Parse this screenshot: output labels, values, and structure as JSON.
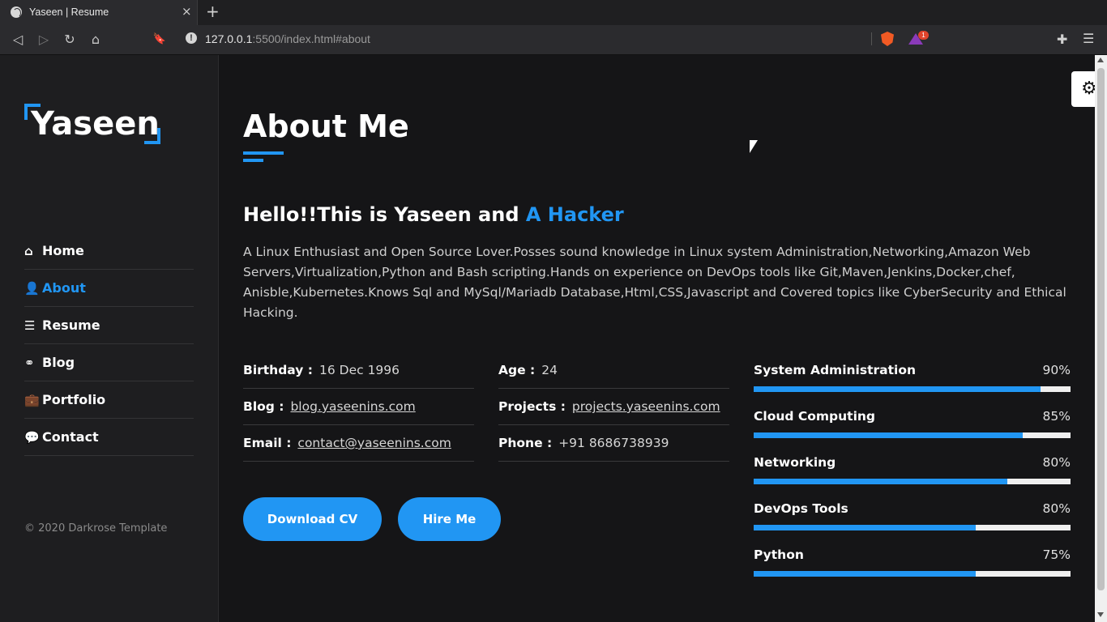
{
  "browser": {
    "tab_title": "Yaseen | Resume",
    "tab_close": "×",
    "new_tab": "+",
    "url_host": "127.0.0.1",
    "url_rest": ":5500/index.html#about",
    "security_icon": "!",
    "rewards_badge": "1",
    "icons": {
      "back": "◁",
      "forward": "▷",
      "reload": "↻",
      "home": "⌂",
      "bookmark": "🔖",
      "extensions": "✚",
      "menu": "☰"
    }
  },
  "sidebar": {
    "logo": "Yaseen",
    "nav": [
      {
        "label": "Home",
        "icon": "home-icon",
        "glyph": "⌂",
        "active": false
      },
      {
        "label": "About",
        "icon": "user-icon",
        "glyph": "👤",
        "active": true
      },
      {
        "label": "Resume",
        "icon": "list-icon",
        "glyph": "☰",
        "active": false
      },
      {
        "label": "Blog",
        "icon": "blog-icon",
        "glyph": "⚭",
        "active": false
      },
      {
        "label": "Portfolio",
        "icon": "briefcase-icon",
        "glyph": "💼",
        "active": false
      },
      {
        "label": "Contact",
        "icon": "chat-icon",
        "glyph": "💬",
        "active": false
      }
    ],
    "copyright": "© 2020 Darkrose Template"
  },
  "about": {
    "title": "About Me",
    "hello_prefix": "Hello!!This is Yaseen and ",
    "hello_accent": "A Hacker",
    "bio": "A Linux Enthusiast and Open Source Lover.Posses sound knowledge in Linux system Administration,Networking,Amazon Web Servers,Virtualization,Python and Bash scripting.Hands on experience on DevOps tools like Git,Maven,Jenkins,Docker,chef, Anisble,Kubernetes.Knows Sql and MySql/Mariadb Database,Html,CSS,Javascript and Covered topics like CyberSecurity and Ethical Hacking.",
    "info_left": [
      {
        "label": "Birthday :",
        "value": "16 Dec 1996",
        "link": false
      },
      {
        "label": "Blog :",
        "value": "blog.yaseenins.com",
        "link": true
      },
      {
        "label": "Email :",
        "value": "contact@yaseenins.com",
        "link": true
      }
    ],
    "info_right": [
      {
        "label": "Age :",
        "value": "24",
        "link": false
      },
      {
        "label": "Projects :",
        "value": "projects.yaseenins.com",
        "link": true
      },
      {
        "label": "Phone :",
        "value": "+91 8686738939",
        "link": false
      }
    ],
    "buttons": {
      "download": "Download CV",
      "hire": "Hire Me"
    },
    "skills": [
      {
        "name": "System Administration",
        "pct": "90%",
        "fill": 0.905
      },
      {
        "name": "Cloud Computing",
        "pct": "85%",
        "fill": 0.85
      },
      {
        "name": "Networking",
        "pct": "80%",
        "fill": 0.8
      },
      {
        "name": "DevOps Tools",
        "pct": "80%",
        "fill": 0.7
      },
      {
        "name": "Python",
        "pct": "75%",
        "fill": 0.7
      }
    ]
  },
  "settings_icon": "⚙",
  "colors": {
    "accent": "#2196f3",
    "background": "#151517",
    "sidebar": "#1e1e20"
  }
}
